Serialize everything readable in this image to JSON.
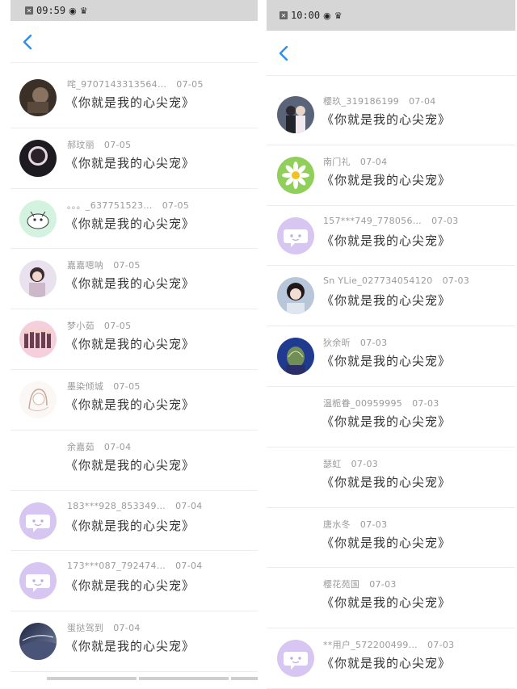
{
  "left": {
    "status": {
      "time": "09:59",
      "icons": [
        "close-box-icon",
        "weibo-icon",
        "crown-icon"
      ]
    },
    "nav": {
      "back_icon": "chevron-left-icon"
    },
    "comments": [
      {
        "user": "咤_9707143313564…",
        "date": "07-05",
        "text": "《你就是我的心尖宠》",
        "avatar": "photo-dark"
      },
      {
        "user": "郝玟丽",
        "date": "07-05",
        "text": "《你就是我的心尖宠》",
        "avatar": "photo-silhouette"
      },
      {
        "user": "。。。_637751523…",
        "date": "07-05",
        "text": "《你就是我的心尖宠》",
        "avatar": "cartoon-green"
      },
      {
        "user": "嘉嘉嗯呐",
        "date": "07-05",
        "text": "《你就是我的心尖宠》",
        "avatar": "photo-girl"
      },
      {
        "user": "梦小茹",
        "date": "07-05",
        "text": "《你就是我的心尖宠》",
        "avatar": "photo-group"
      },
      {
        "user": "墨染倾城",
        "date": "07-05",
        "text": "《你就是我的心尖宠》",
        "avatar": "sketch-girl"
      },
      {
        "user": "余嘉茹",
        "date": "07-04",
        "text": "《你就是我的心尖宠》",
        "avatar": "none"
      },
      {
        "user": "183***928_853349…",
        "date": "07-04",
        "text": "《你就是我的心尖宠》",
        "avatar": "default-chat"
      },
      {
        "user": "173***087_792474…",
        "date": "07-04",
        "text": "《你就是我的心尖宠》",
        "avatar": "default-chat"
      },
      {
        "user": "蛋挞驾到",
        "date": "07-04",
        "text": "《你就是我的心尖宠》",
        "avatar": "photo-sky"
      }
    ]
  },
  "right": {
    "status": {
      "time": "10:00",
      "icons": [
        "close-box-icon",
        "weibo-icon",
        "crown-icon"
      ]
    },
    "nav": {
      "back_icon": "chevron-left-icon"
    },
    "comments": [
      {
        "user": "樱玖_319186199",
        "date": "07-04",
        "text": "《你就是我的心尖宠》",
        "avatar": "photo-couple"
      },
      {
        "user": "南门礼",
        "date": "07-04",
        "text": "《你就是我的心尖宠》",
        "avatar": "photo-daisy"
      },
      {
        "user": "157***749_778056…",
        "date": "07-03",
        "text": "《你就是我的心尖宠》",
        "avatar": "default-chat"
      },
      {
        "user": "Sn YLie_027734054120",
        "date": "07-03",
        "text": "《你就是我的心尖宠》",
        "avatar": "photo-woman"
      },
      {
        "user": "狄余昕",
        "date": "07-03",
        "text": "《你就是我的心尖宠》",
        "avatar": "photo-cactus"
      },
      {
        "user": "温栀眷_00959995",
        "date": "07-03",
        "text": "《你就是我的心尖宠》",
        "avatar": "none"
      },
      {
        "user": "瑟虹",
        "date": "07-03",
        "text": "《你就是我的心尖宠》",
        "avatar": "none"
      },
      {
        "user": "唐水冬",
        "date": "07-03",
        "text": "《你就是我的心尖宠》",
        "avatar": "none"
      },
      {
        "user": "樱花苑国",
        "date": "07-03",
        "text": "《你就是我的心尖宠》",
        "avatar": "none"
      },
      {
        "user": "**用户_572200499…",
        "date": "07-03",
        "text": "《你就是我的心尖宠》",
        "avatar": "default-chat"
      }
    ]
  },
  "colors": {
    "accent": "#2b8ef0",
    "default_avatar": "#d8c6f2"
  }
}
